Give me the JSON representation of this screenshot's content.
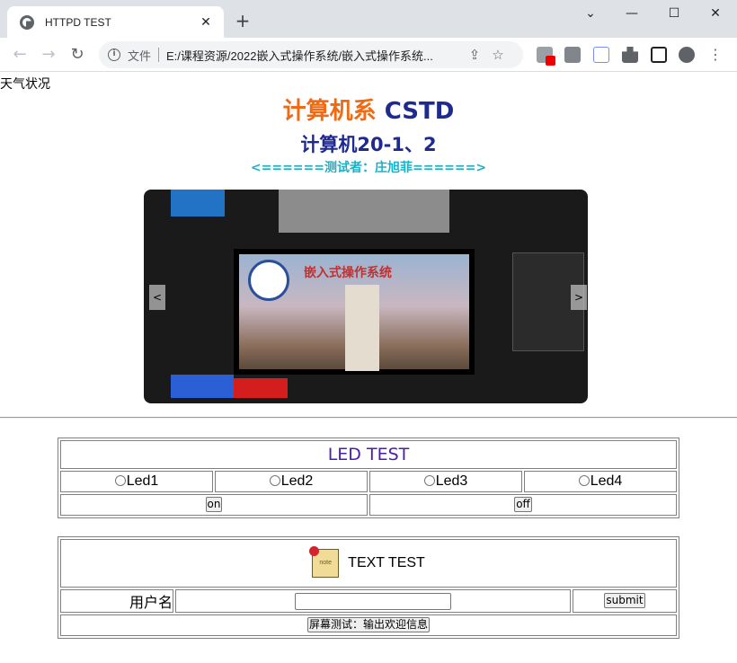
{
  "browser": {
    "tab_title": "HTTPD TEST",
    "tab_close": "✕",
    "new_tab": "+",
    "window_controls": {
      "minimize": "⌄",
      "min": "—",
      "max": "☐",
      "close": "✕"
    },
    "nav": {
      "back": "←",
      "forward": "→",
      "reload": "↻"
    },
    "address": {
      "security_label": "文件",
      "url": "E:/课程资源/2022嵌入式操作系统/嵌入式操作系统..."
    },
    "extension_icons": [
      "share-icon",
      "star-icon",
      "extension-red-badge-icon",
      "search-ext-icon",
      "vue-ext-icon",
      "puzzle-icon",
      "sidebar-icon",
      "profile-icon",
      "menu-icon"
    ]
  },
  "page": {
    "weather_label": "天气状况",
    "header": {
      "part_orange": "计算机系",
      "part_blue": "CSTD"
    },
    "class_name": "计算机20-1、2",
    "tester_line": "<======测试者：庄旭菲======>",
    "carousel": {
      "prev": "<",
      "next": ">",
      "slide_title": "嵌入式操作系统"
    },
    "led_test": {
      "title": "LED TEST",
      "leds": [
        "Led1",
        "Led2",
        "Led3",
        "Led4"
      ],
      "on_label": "on",
      "off_label": "off"
    },
    "text_test": {
      "note_label": "note",
      "title": "TEXT TEST",
      "username_label": "用户名",
      "username_value": "",
      "submit_label": "submit",
      "screen_button_label": "屏幕测试：输出欢迎信息"
    }
  },
  "colors": {
    "orange": "#f06a13",
    "navy": "#1f2a8f",
    "cyan": "#19b3c9",
    "purple": "#4b1cb0"
  }
}
